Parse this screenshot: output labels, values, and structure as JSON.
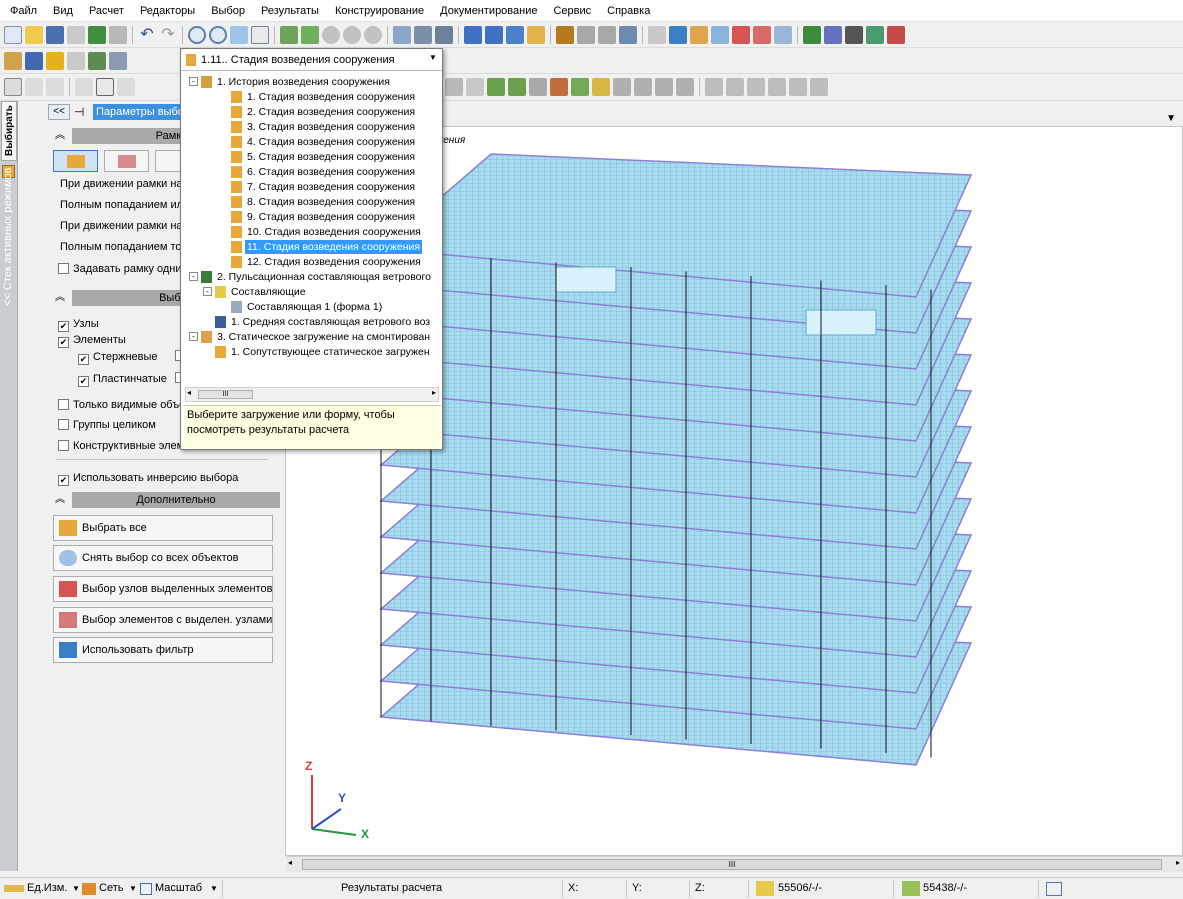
{
  "menu": [
    "Файл",
    "Вид",
    "Расчет",
    "Редакторы",
    "Выбор",
    "Результаты",
    "Конструирование",
    "Документирование",
    "Сервис",
    "Справка"
  ],
  "combo": {
    "value": "1.11.. Стадия возведения сооружения"
  },
  "side_tab": {
    "stack": "<< Стек активных режимов",
    "select": "Выбирать"
  },
  "panel": {
    "params_label": "Параметры выбор",
    "frame_header": "Рамка в",
    "frame_rows": [
      "При движении рамки нал",
      "Полным попаданием или",
      "При движении рамки нап",
      "Полным попаданием толь"
    ],
    "frame_checkbox": "Задавать рамку одним",
    "select_header": "Выбир",
    "nodes": "Узлы",
    "elements": "Элементы",
    "rod": "Стержневые",
    "plate": "Пластинчатые",
    "visible_only": "Только видимые объе",
    "groups": "Группы целиком",
    "constructive": "Конструктивные элем",
    "inversion": "Использовать инверсию выбора",
    "extra_header": "Дополнительно",
    "buttons": [
      "Выбрать все",
      "Снять выбор со всех объектов",
      "Выбор узлов выделенных элементов",
      "Выбор элементов с выделен. узлами",
      "Использовать фильтр"
    ]
  },
  "dropdown": {
    "header": "1.11.. Стадия возведения сооружения",
    "items": [
      "1. История возведения сооружения",
      "1. Стадия возведения сооружения",
      "2. Стадия возведения сооружения",
      "3. Стадия возведения сооружения",
      "4. Стадия возведения сооружения",
      "5. Стадия возведения сооружения",
      "6. Стадия возведения сооружения",
      "7. Стадия возведения сооружения",
      "8. Стадия возведения сооружения",
      "9. Стадия возведения сооружения",
      "10. Стадия возведения сооружения",
      "11. Стадия возведения сооружения",
      "12. Стадия возведения сооружения",
      "2. Пульсационная составляющая ветрового",
      "Составляющие",
      "Составляющая 1 (форма 1)",
      "1. Средняя составляющая ветрового воз",
      "3. Статическое загружение на смонтирован",
      "1. Сопутствующее статическое загружен"
    ],
    "scroll_mark": "III",
    "tip": "Выберите загружение или форму, чтобы посмотреть результаты расчета"
  },
  "viewport": {
    "caption": "ружения",
    "axis_x": "X",
    "axis_y": "Y",
    "axis_z": "Z"
  },
  "hscroll_mark": "III",
  "status": {
    "units": "Ед.Изм.",
    "grid": "Сеть",
    "scale": "Масштаб",
    "mode": "Результаты расчета",
    "x": "X:",
    "y": "Y:",
    "z": "Z:",
    "nodes_count": "55506/-/-",
    "elems_count": "55438/-/-"
  },
  "colors": {
    "mesh": "#a9dcf0",
    "mesh_line": "#5fa8c8",
    "slab_edge": "#8b80d8",
    "selected": "#3399ff"
  }
}
